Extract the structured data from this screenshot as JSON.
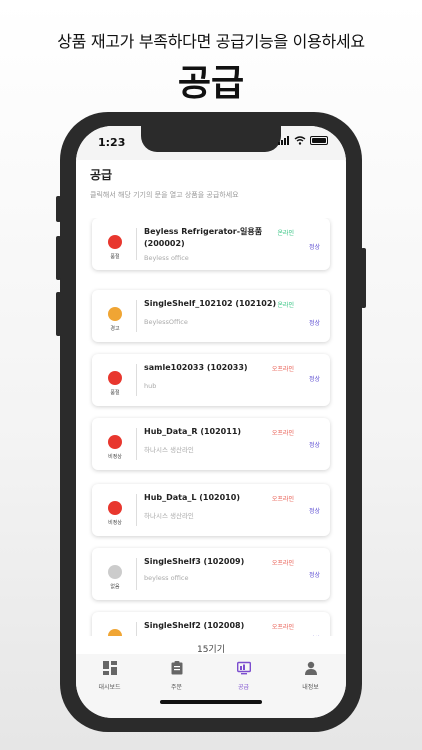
{
  "promo": {
    "subtitle": "상품 재고가 부족하다면 공급기능을 이용하세요",
    "title": "공급"
  },
  "status_bar": {
    "time": "1:23"
  },
  "page": {
    "title": "공급",
    "description": "클릭해서 해당 기기의 문을 열고 상품을 공급하세요"
  },
  "devices": [
    {
      "name": "Beyless Refrigerator-일용품 (200002)",
      "location": "Beyless office",
      "status_label": "품절",
      "status_color": "#e8372e",
      "connection": "온라인",
      "connection_color": "#2ec27e",
      "condition": "정상"
    },
    {
      "name": "SingleShelf_102102 (102102)",
      "location": "BeylessOffice",
      "status_label": "경고",
      "status_color": "#f0a534",
      "connection": "온라인",
      "connection_color": "#2ec27e",
      "condition": "정상"
    },
    {
      "name": "samle102033 (102033)",
      "location": "hub",
      "status_label": "품절",
      "status_color": "#e8372e",
      "connection": "오프라인",
      "connection_color": "#e85a4f",
      "condition": "정상"
    },
    {
      "name": "Hub_Data_R (102011)",
      "location": "하나시스 생산라인",
      "status_label": "비정상",
      "status_color": "#e8372e",
      "connection": "오프라인",
      "connection_color": "#e85a4f",
      "condition": "정상"
    },
    {
      "name": "Hub_Data_L (102010)",
      "location": "하나시스 생산라인",
      "status_label": "비정상",
      "status_color": "#e8372e",
      "connection": "오프라인",
      "connection_color": "#e85a4f",
      "condition": "정상"
    },
    {
      "name": "SingleShelf3 (102009)",
      "location": "beyless office",
      "status_label": "없음",
      "status_color": "#cccccc",
      "connection": "오프라인",
      "connection_color": "#e85a4f",
      "condition": "정상"
    },
    {
      "name": "SingleShelf2 (102008)",
      "location": "",
      "status_label": "",
      "status_color": "#f0a534",
      "connection": "오프라인",
      "connection_color": "#e85a4f",
      "condition": "정상"
    }
  ],
  "device_count": "15기기",
  "tabs": [
    {
      "label": "대시보드",
      "icon": "dashboard-icon"
    },
    {
      "label": "주문",
      "icon": "clipboard-icon"
    },
    {
      "label": "공급",
      "icon": "supply-icon",
      "active": true
    },
    {
      "label": "내정보",
      "icon": "person-icon"
    }
  ],
  "colors": {
    "accent": "#7c4dcf",
    "online": "#2ec27e",
    "offline": "#e85a4f",
    "condition": "#5a4bd1"
  }
}
